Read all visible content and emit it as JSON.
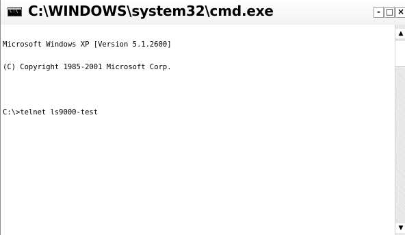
{
  "window": {
    "title": "C:\\WINDOWS\\system32\\cmd.exe",
    "icon": "cmd-icon",
    "icon_text": "C:\\",
    "buttons": {
      "minimize": "-",
      "maximize": "□",
      "close": "×"
    }
  },
  "console": {
    "lines": [
      "Microsoft Windows XP [Version 5.1.2600]",
      "(C) Copyright 1985-2001 Microsoft Corp.",
      "",
      "C:\\>telnet ls9000-test"
    ]
  },
  "scrollbar": {
    "up_arrow": "▲",
    "down_arrow": "▼"
  }
}
